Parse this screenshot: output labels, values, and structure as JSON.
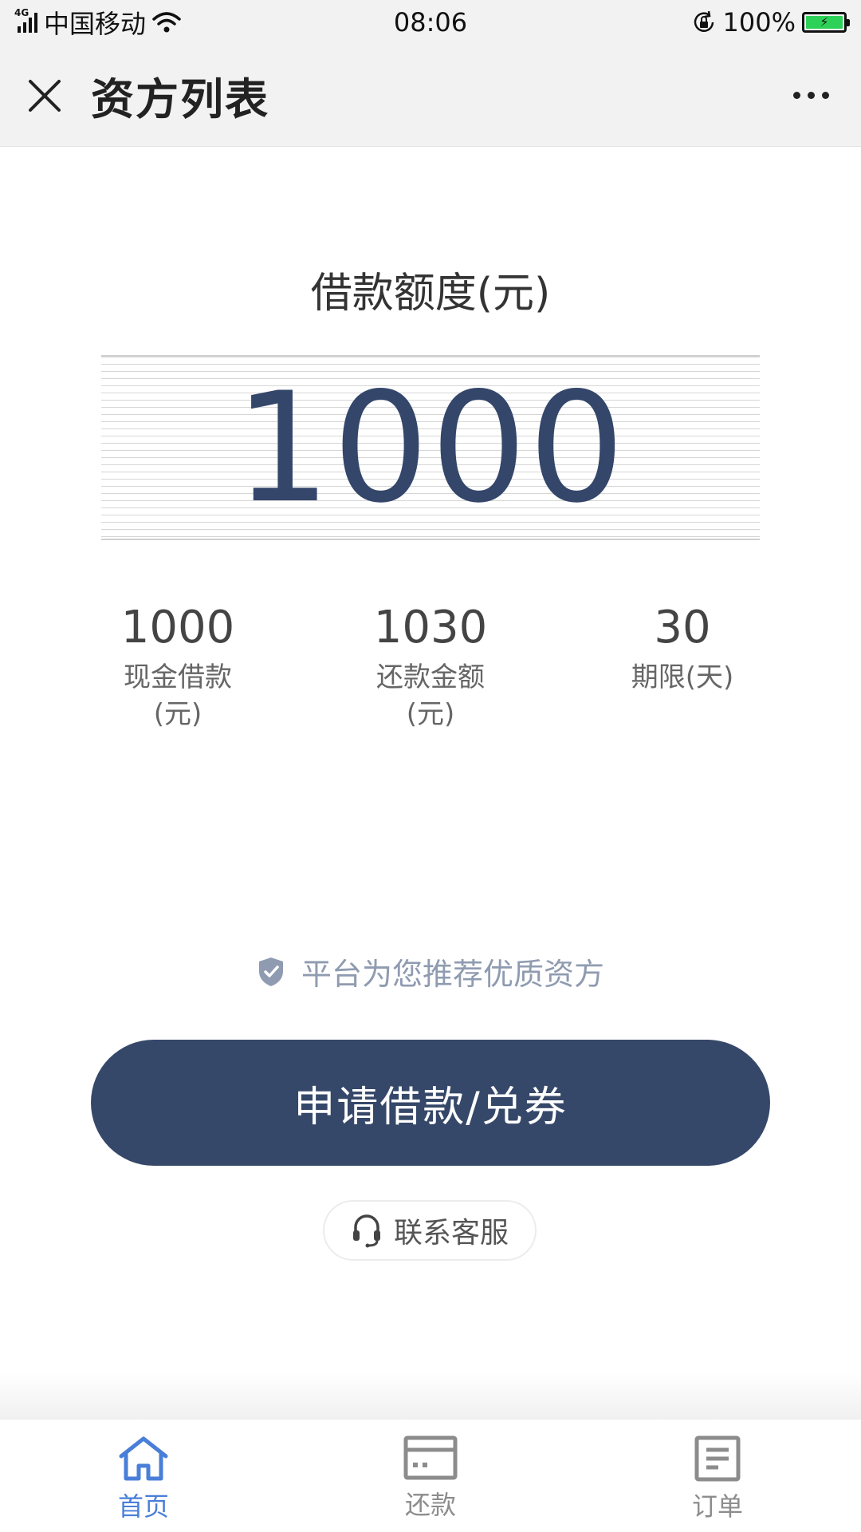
{
  "status_bar": {
    "network": "4G",
    "carrier": "中国移动",
    "time": "08:06",
    "battery": "100%"
  },
  "header": {
    "title": "资方列表"
  },
  "main": {
    "quota_label": "借款额度(元)",
    "amount": "1000",
    "stats": [
      {
        "value": "1000",
        "label_line1": "现金借款",
        "label_line2": "(元)"
      },
      {
        "value": "1030",
        "label_line1": "还款金额",
        "label_line2": "(元)"
      },
      {
        "value": "30",
        "label_line1": "期限(天)",
        "label_line2": ""
      }
    ],
    "trust_text": "平台为您推荐优质资方",
    "apply_button": "申请借款/兑券",
    "service_button": "联系客服"
  },
  "tabbar": {
    "items": [
      {
        "label": "首页",
        "icon": "home-icon",
        "active": true
      },
      {
        "label": "还款",
        "icon": "card-icon",
        "active": false
      },
      {
        "label": "订单",
        "icon": "document-icon",
        "active": false
      }
    ]
  },
  "colors": {
    "primary": "#364869",
    "active_tab": "#4a7fd8",
    "inactive_tab": "#8c8c8c",
    "trust": "#8f9bb0"
  }
}
